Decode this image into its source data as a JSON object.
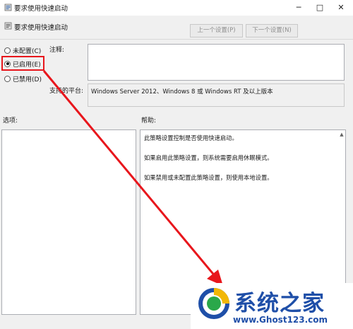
{
  "window": {
    "title": "要求使用快速启动",
    "minimize": "─",
    "maximize": "□",
    "close": "✕"
  },
  "header": {
    "setting_name": "要求使用快速启动",
    "prev_label": "上一个设置(P)",
    "next_label": "下一个设置(N)"
  },
  "state": {
    "options": [
      {
        "label": "未配置(C)",
        "selected": false
      },
      {
        "label": "已启用(E)",
        "selected": true
      },
      {
        "label": "已禁用(D)",
        "selected": false
      }
    ]
  },
  "comment": {
    "label": "注释:",
    "value": ""
  },
  "platform": {
    "label": "支持的平台:",
    "value": "Windows Server 2012、Windows 8 或 Windows RT 及以上版本"
  },
  "options_pane": {
    "label": "选项:"
  },
  "help_pane": {
    "label": "帮助:",
    "paragraphs": [
      "此策略设置控制是否使用快速启动。",
      "如果启用此策略设置，则系统需要启用休眠模式。",
      "如果禁用或未配置此策略设置，则使用本地设置。"
    ]
  },
  "watermark": {
    "brand": "系统之家",
    "url": "www.Ghost123.com"
  },
  "colors": {
    "highlight": "#e8161c",
    "window_bg": "#f0f0f0",
    "brand_blue": "#1f4fa8"
  }
}
